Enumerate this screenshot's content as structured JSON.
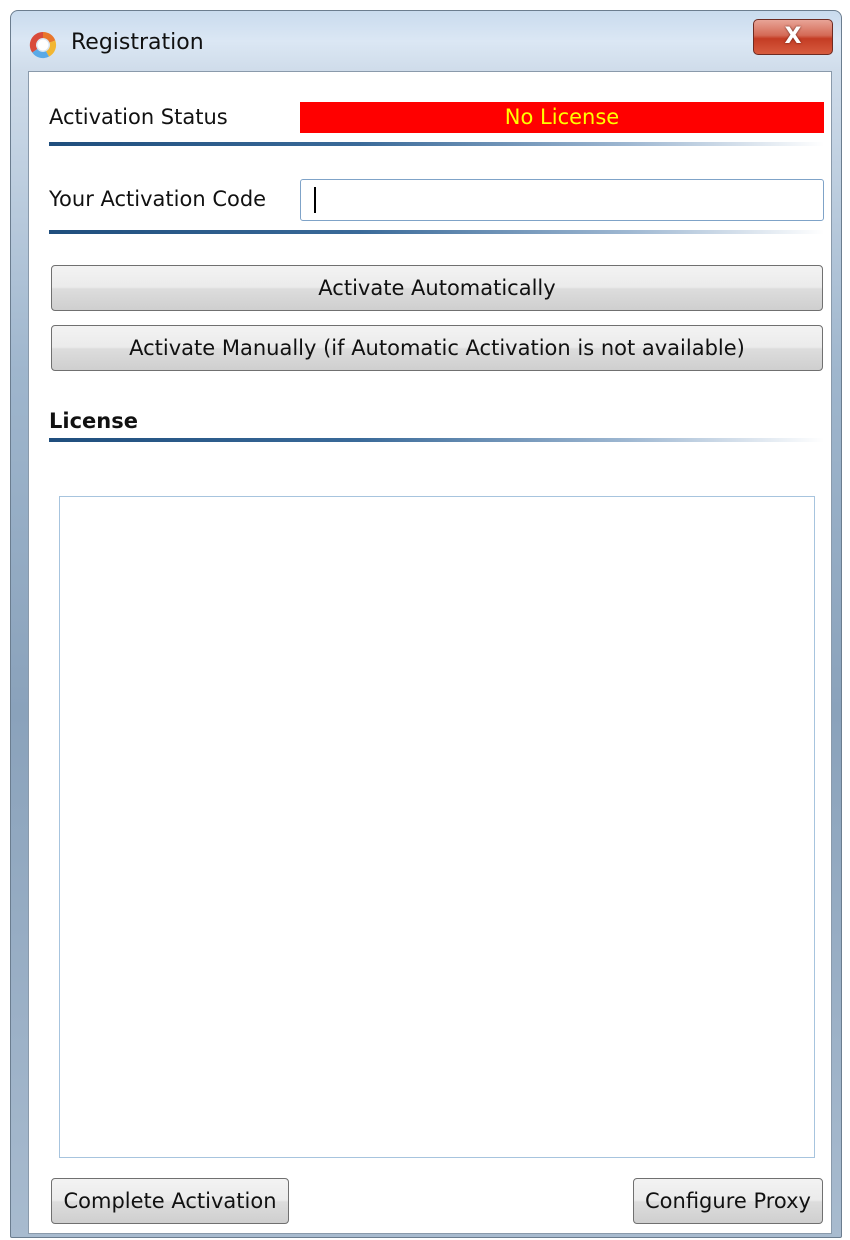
{
  "window": {
    "title": "Registration",
    "close_label": "X"
  },
  "activation_status": {
    "label": "Activation Status",
    "value": "No License",
    "value_bg_color": "#ff0000",
    "value_text_color": "#ffff00"
  },
  "activation_code": {
    "label": "Your Activation Code",
    "value": "",
    "placeholder": ""
  },
  "buttons": {
    "activate_auto": "Activate Automatically",
    "activate_manual": "Activate Manually (if Automatic Activation is not available)",
    "complete_activation": "Complete Activation",
    "configure_proxy": "Configure Proxy"
  },
  "license": {
    "heading": "License",
    "text": ""
  },
  "icons": {
    "app": "app-logo-icon",
    "close": "close-icon"
  }
}
